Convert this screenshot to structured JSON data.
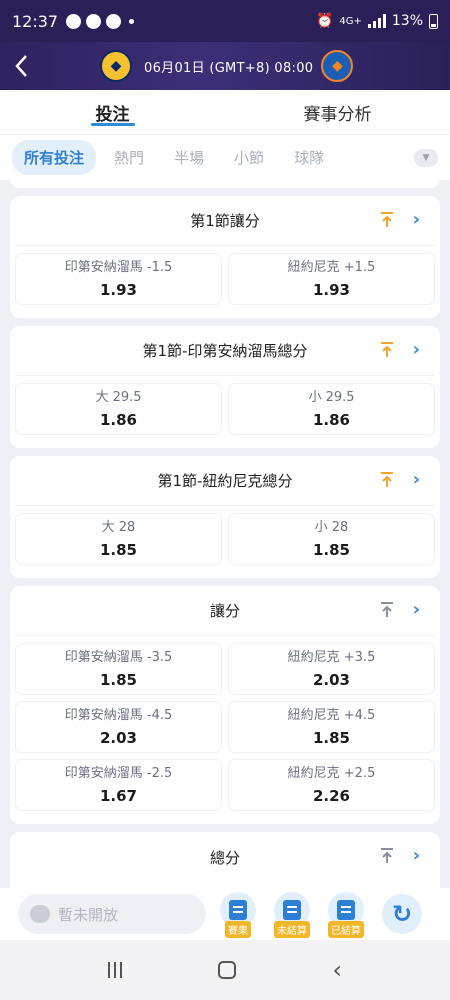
{
  "status_bar": {
    "time": "12:37",
    "network": "4G+",
    "battery": "13%"
  },
  "header": {
    "match_info": "06月01日 (GMT+8)   08:00"
  },
  "tabs": [
    {
      "label": "投注",
      "active": true
    },
    {
      "label": "賽事分析",
      "active": false
    }
  ],
  "filters": [
    {
      "label": "所有投注",
      "active": true
    },
    {
      "label": "熱門",
      "active": false
    },
    {
      "label": "半場",
      "active": false
    },
    {
      "label": "小節",
      "active": false
    },
    {
      "label": "球隊",
      "active": false
    }
  ],
  "markets": [
    {
      "title": "第1節讓分",
      "pinned": true,
      "rows": [
        [
          {
            "label": "印第安納溜馬 -1.5",
            "odds": "1.93"
          },
          {
            "label": "紐約尼克 +1.5",
            "odds": "1.93"
          }
        ]
      ]
    },
    {
      "title": "第1節-印第安納溜馬總分",
      "pinned": true,
      "rows": [
        [
          {
            "label": "大 29.5",
            "odds": "1.86"
          },
          {
            "label": "小 29.5",
            "odds": "1.86"
          }
        ]
      ]
    },
    {
      "title": "第1節-紐約尼克總分",
      "pinned": true,
      "rows": [
        [
          {
            "label": "大 28",
            "odds": "1.85"
          },
          {
            "label": "小 28",
            "odds": "1.85"
          }
        ]
      ]
    },
    {
      "title": "讓分",
      "pinned": false,
      "rows": [
        [
          {
            "label": "印第安納溜馬 -3.5",
            "odds": "1.85"
          },
          {
            "label": "紐約尼克 +3.5",
            "odds": "2.03"
          }
        ],
        [
          {
            "label": "印第安納溜馬 -4.5",
            "odds": "2.03"
          },
          {
            "label": "紐約尼克 +4.5",
            "odds": "1.85"
          }
        ],
        [
          {
            "label": "印第安納溜馬 -2.5",
            "odds": "1.67"
          },
          {
            "label": "紐約尼克 +2.5",
            "odds": "2.26"
          }
        ]
      ]
    },
    {
      "title": "總分",
      "pinned": false,
      "rows": []
    }
  ],
  "action_bar": {
    "input_placeholder": "暫未開放",
    "buttons": [
      {
        "label": "賽果"
      },
      {
        "label": "未結算"
      },
      {
        "label": "已結算"
      }
    ]
  },
  "colors": {
    "accent": "#2f8bd6",
    "header_bg": "#2b1f58",
    "pin_active": "#f2a32b",
    "pin_inactive": "#8a8f9c"
  }
}
